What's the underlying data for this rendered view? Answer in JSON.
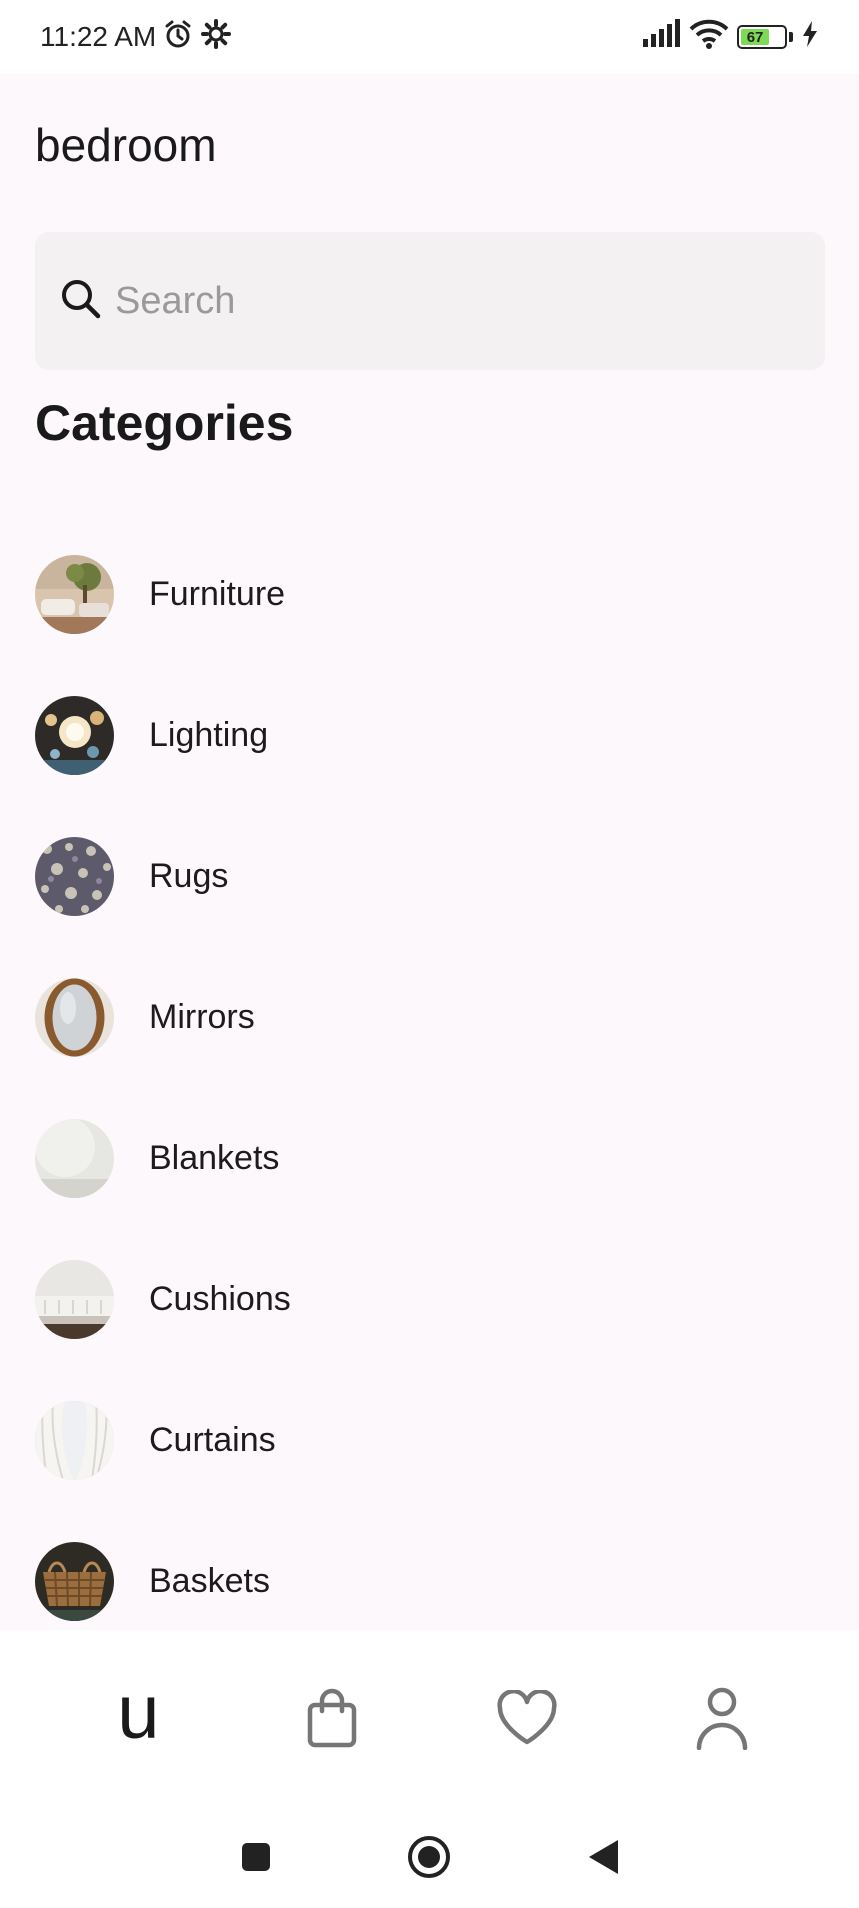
{
  "status_bar": {
    "time": "11:22 AM",
    "battery_level": "67",
    "icons": [
      "alarm-icon",
      "settings-icon",
      "signal-icon",
      "wifi-icon",
      "battery-icon",
      "charging-icon"
    ]
  },
  "header": {
    "title": "bedroom"
  },
  "search": {
    "placeholder": "Search",
    "value": ""
  },
  "categories": {
    "title": "Categories",
    "items": [
      {
        "label": "Furniture"
      },
      {
        "label": "Lighting"
      },
      {
        "label": "Rugs"
      },
      {
        "label": "Mirrors"
      },
      {
        "label": "Blankets"
      },
      {
        "label": "Cushions"
      },
      {
        "label": "Curtains"
      },
      {
        "label": "Baskets"
      }
    ]
  },
  "bottom_nav": {
    "brand": "u",
    "items": [
      "home-logo",
      "bag-icon",
      "heart-icon",
      "profile-icon"
    ]
  },
  "colors": {
    "background": "#fdf8fb",
    "search_bg": "#f3f1f2",
    "battery_fill": "#7ed957"
  }
}
